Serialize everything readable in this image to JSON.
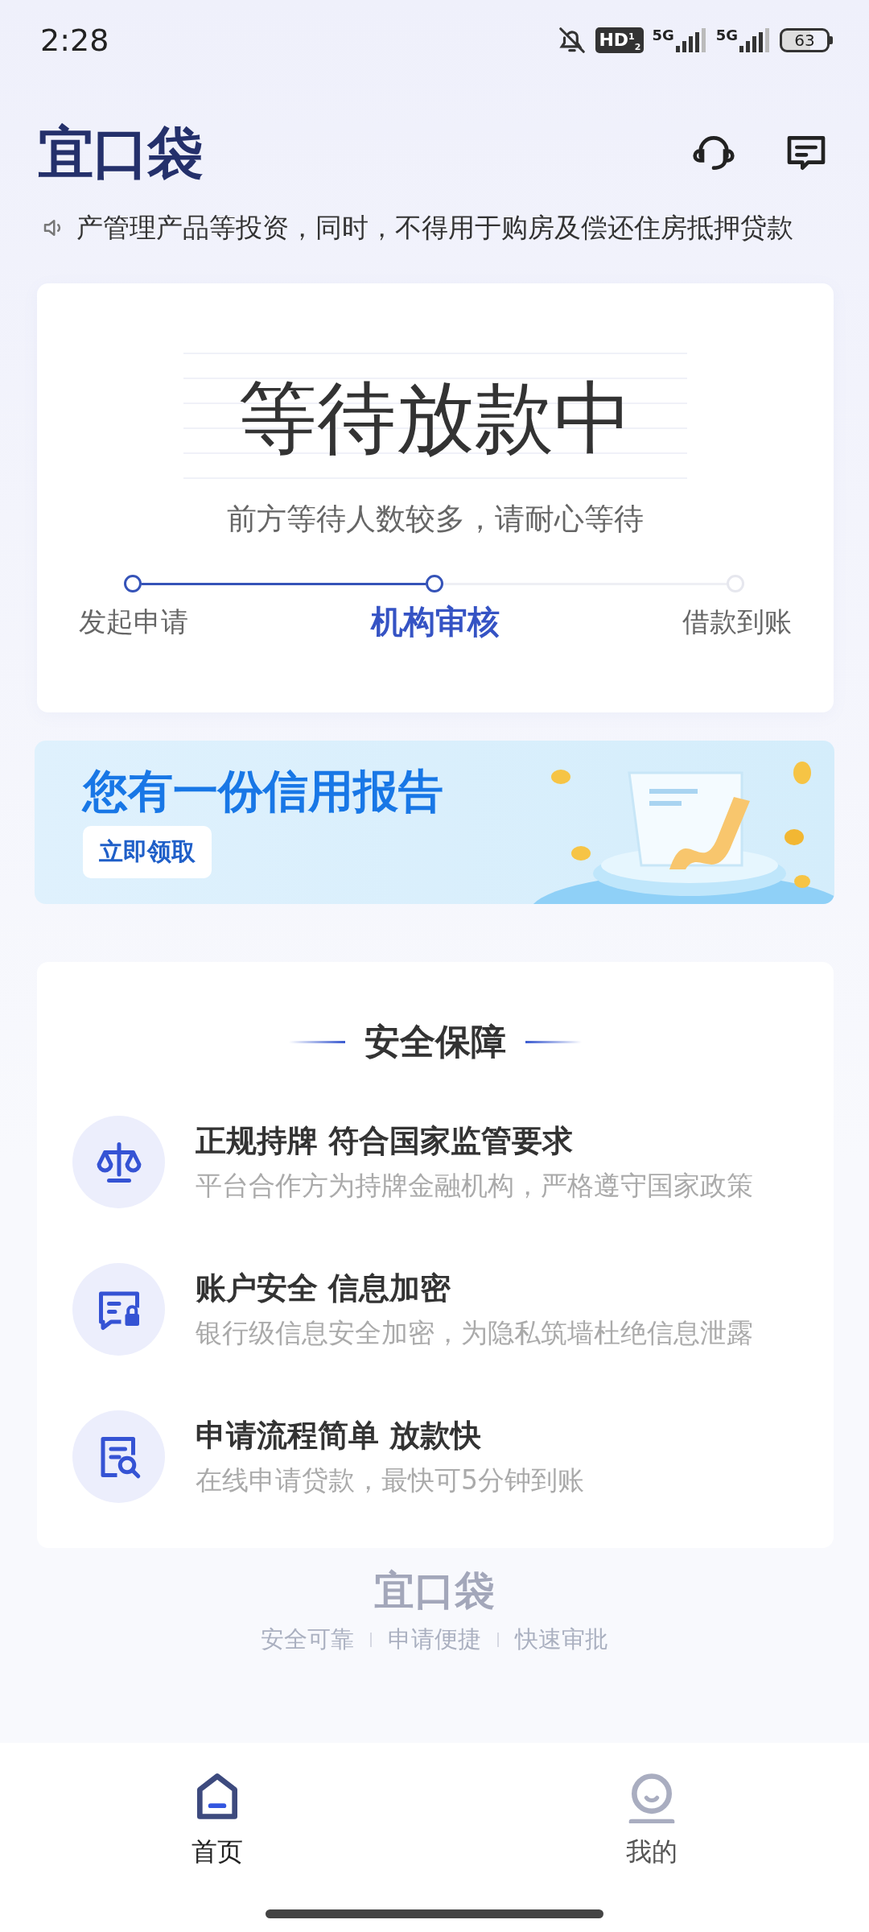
{
  "status_bar": {
    "time": "2:28",
    "hd_badge": "HD$^{1}$$_{2}$",
    "network_labels": [
      "5G",
      "5G"
    ],
    "battery": "63"
  },
  "header": {
    "logo": "宜口袋",
    "notice": "产管理产品等投资，同时，不得用于购房及偿还住房抵押贷款"
  },
  "status_card": {
    "title": "等待放款中",
    "subtitle": "前方等待人数较多，请耐心等待",
    "steps": [
      {
        "label": "发起申请",
        "done": true,
        "selected": false
      },
      {
        "label": "机构审核",
        "done": true,
        "selected": true
      },
      {
        "label": "借款到账",
        "done": false,
        "selected": false
      }
    ]
  },
  "banner": {
    "title": "您有一份信用报告",
    "button": "立即领取"
  },
  "security": {
    "title": "安全保障",
    "items": [
      {
        "kind": "license",
        "title": "正规持牌 符合国家监管要求",
        "description": "平台合作方为持牌金融机构，严格遵守国家政策"
      },
      {
        "kind": "account",
        "title": "账户安全 信息加密",
        "description": "银行级信息安全加密，为隐私筑墙杜绝信息泄露"
      },
      {
        "kind": "process",
        "title": "申请流程简单 放款快",
        "description": "在线申请贷款，最快可5分钟到账"
      }
    ]
  },
  "footer": {
    "logo": "宜口袋",
    "taglines": [
      "安全可靠",
      "申请便捷",
      "快速审批"
    ]
  },
  "tab_bar": [
    {
      "kind": "home",
      "label": "首页",
      "selected": true
    },
    {
      "kind": "profile",
      "label": "我的",
      "selected": false
    }
  ]
}
